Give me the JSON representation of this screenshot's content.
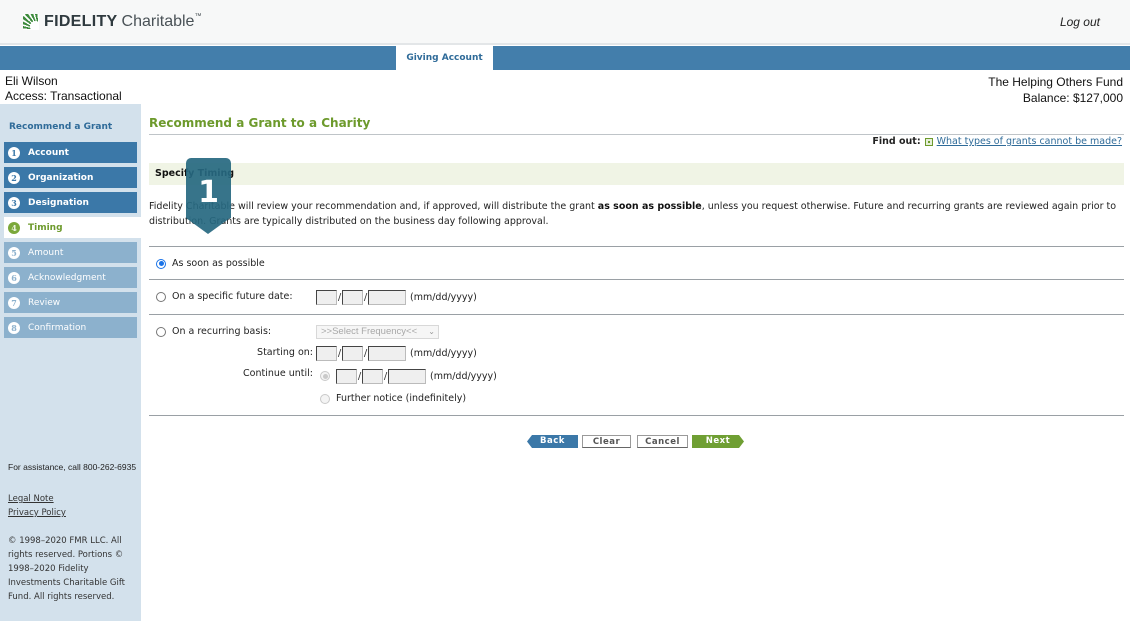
{
  "header": {
    "logo_bold": "FIDELITY",
    "logo_light": "Charitable",
    "logo_tm": "™",
    "logout": "Log out"
  },
  "nav": {
    "active_tab": "Giving Account"
  },
  "account": {
    "user_name": "Eli Wilson",
    "access": "Access: Transactional",
    "fund_name": "The Helping Others Fund",
    "balance": "Balance: $127,000"
  },
  "sidebar": {
    "title": "Recommend a Grant",
    "steps": [
      {
        "num": "1",
        "label": "Account",
        "state": "done"
      },
      {
        "num": "2",
        "label": "Organization",
        "state": "done"
      },
      {
        "num": "3",
        "label": "Designation",
        "state": "done"
      },
      {
        "num": "4",
        "label": "Timing",
        "state": "current"
      },
      {
        "num": "5",
        "label": "Amount",
        "state": "todo"
      },
      {
        "num": "6",
        "label": "Acknowledgment",
        "state": "todo"
      },
      {
        "num": "7",
        "label": "Review",
        "state": "todo"
      },
      {
        "num": "8",
        "label": "Confirmation",
        "state": "todo"
      }
    ],
    "assistance": "For assistance, call 800-262-6935",
    "links": [
      "Legal Note",
      "Privacy Policy"
    ],
    "copyright": "© 1998–2020 FMR LLC. All rights reserved. Portions © 1998–2020 Fidelity Investments Charitable Gift Fund. All rights reserved."
  },
  "main": {
    "title": "Recommend a Grant to a Charity",
    "find_out_label": "Find out:",
    "find_out_link": "What types of grants cannot be made?",
    "section_title": "Specify Timing",
    "intro_before": "Fidelity Charitable will review your recommendation and, if approved, will distribute the grant ",
    "intro_bold": "as soon as possible",
    "intro_after": ", unless you request otherwise. Future and recurring grants are reviewed again prior to distribution. Grants are typically distributed on the business day following approval.",
    "options": {
      "asap": {
        "label": "As soon as possible",
        "selected": true
      },
      "future": {
        "label": "On a specific future date:",
        "selected": false
      },
      "recurring": {
        "label": "On a recurring basis:",
        "selected": false
      }
    },
    "date_format": "(mm/dd/yyyy)",
    "frequency_select": ">>Select Frequency<<",
    "starting_on_label": "Starting on:",
    "continue_until_label": "Continue until:",
    "further_notice_label": "Further notice (indefinitely)",
    "date_values": {
      "future": {
        "mm": "",
        "dd": "",
        "yyyy": ""
      },
      "start": {
        "mm": "",
        "dd": "",
        "yyyy": ""
      },
      "until": {
        "mm": "",
        "dd": "",
        "yyyy": ""
      }
    }
  },
  "buttons": {
    "back": "Back",
    "clear": "Clear",
    "cancel": "Cancel",
    "next": "Next"
  },
  "colors": {
    "nav_blue": "#437eab",
    "step_done": "#3b78a8",
    "step_todo": "#8cb1cd",
    "accent_green": "#6d9a2c",
    "section_bg": "#f0f4e5",
    "sidebar_bg": "#d3e1ec",
    "marker": "#266880"
  },
  "annotation": {
    "marker_number": "1"
  }
}
